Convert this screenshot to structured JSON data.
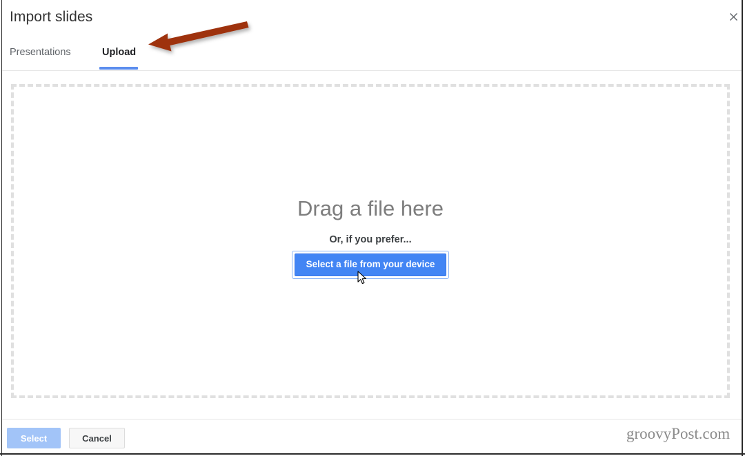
{
  "window": {
    "title": "Import slides",
    "close_icon": "close-icon"
  },
  "tabs": [
    {
      "label": "Presentations",
      "active": false
    },
    {
      "label": "Upload",
      "active": true
    }
  ],
  "dropzone": {
    "drag_label": "Drag a file here",
    "or_label": "Or, if you prefer...",
    "select_file_button": "Select a file from your device"
  },
  "footer": {
    "select_label": "Select",
    "cancel_label": "Cancel"
  },
  "watermark": {
    "text": "groovyPost.com"
  },
  "annotation": {
    "arrow_icon": "arrow-left-pointer",
    "color": "#9e3310"
  },
  "cursor": {
    "icon": "mouse-pointer-icon"
  },
  "colors": {
    "accent_blue": "#4285f4",
    "tab_indicator": "#5b8dee",
    "disabled_blue": "#a2c4f8",
    "dashed_border": "#e0e0e0",
    "annotation_red": "#9e3310"
  }
}
